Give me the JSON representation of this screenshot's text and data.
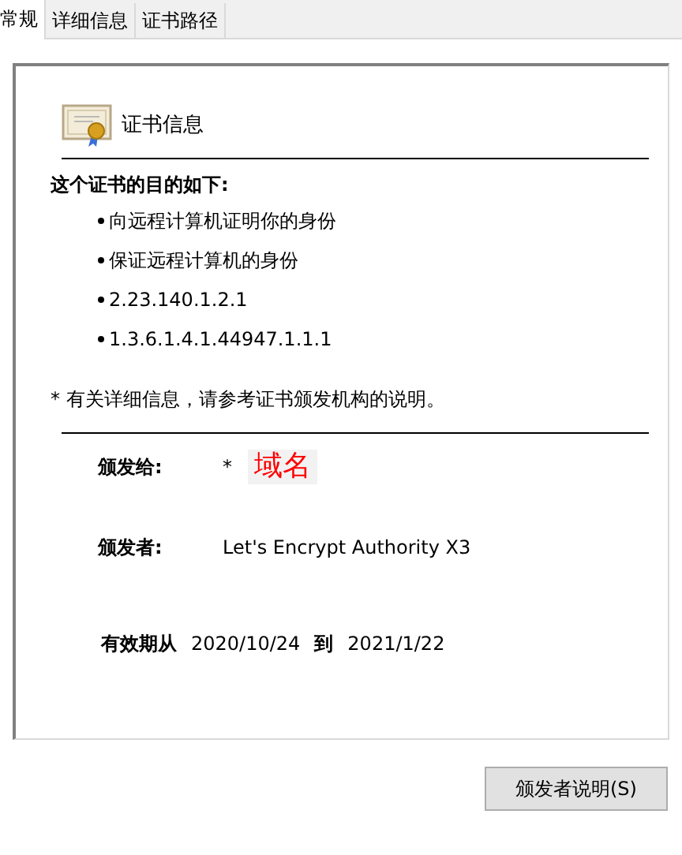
{
  "tabs": [
    {
      "label": "常规",
      "selected": true
    },
    {
      "label": "详细信息",
      "selected": false
    },
    {
      "label": "证书路径",
      "selected": false
    }
  ],
  "certificate": {
    "heading": "证书信息",
    "purpose_title": "这个证书的目的如下:",
    "purposes": [
      "向远程计算机证明你的身份",
      "保证远程计算机的身份",
      "2.23.140.1.2.1",
      "1.3.6.1.4.1.44947.1.1.1"
    ],
    "note": "* 有关详细信息，请参考证书颁发机构的说明。",
    "issued_to_label": "颁发给:",
    "issued_to_value": "*",
    "issued_to_annotation": "域名",
    "issued_by_label": "颁发者:",
    "issued_by_value": "Let's Encrypt Authority X3",
    "valid_from_label": "有效期从",
    "valid_from": "2020/10/24",
    "valid_to_label": "到",
    "valid_to": "2021/1/22"
  },
  "buttons": [
    {
      "label": "颁发者说明(S)"
    }
  ]
}
